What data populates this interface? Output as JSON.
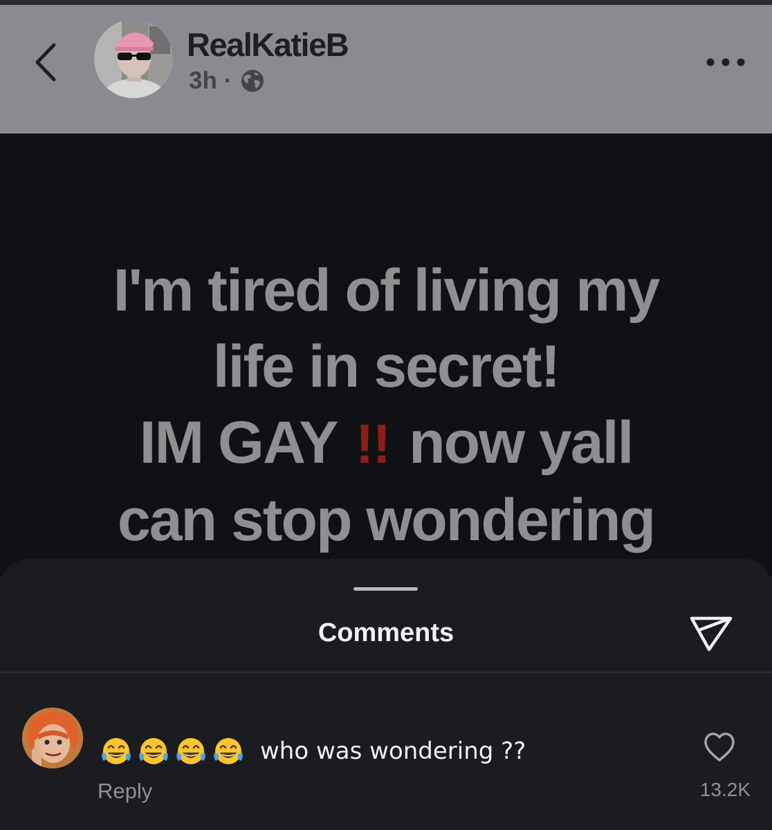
{
  "header": {
    "username": "RealKatieB",
    "time": "3h",
    "separator": "·",
    "back_icon": "chevron-left-icon",
    "more_icon": "more-horizontal-icon",
    "visibility_icon": "globe-icon",
    "background_color": "#898b90"
  },
  "story": {
    "line1": "I'm tired of living my",
    "line2": "life in secret!",
    "line3_start": "IM GAY",
    "line3_emphasis": "!!",
    "line3_end": "now yall",
    "line4": "can stop wondering",
    "text_color": "#8f8f91",
    "emphasis_color": "#8c1d18"
  },
  "comments_sheet": {
    "title": "Comments",
    "share_icon": "send-icon",
    "comment": {
      "emoji": "😂😂😂😂",
      "emoji_icon": "tears-of-joy-emoji-icon",
      "text": "who was wondering ??",
      "reply_label": "Reply",
      "like_icon": "heart-outline-icon",
      "like_count": "13.2K"
    }
  }
}
